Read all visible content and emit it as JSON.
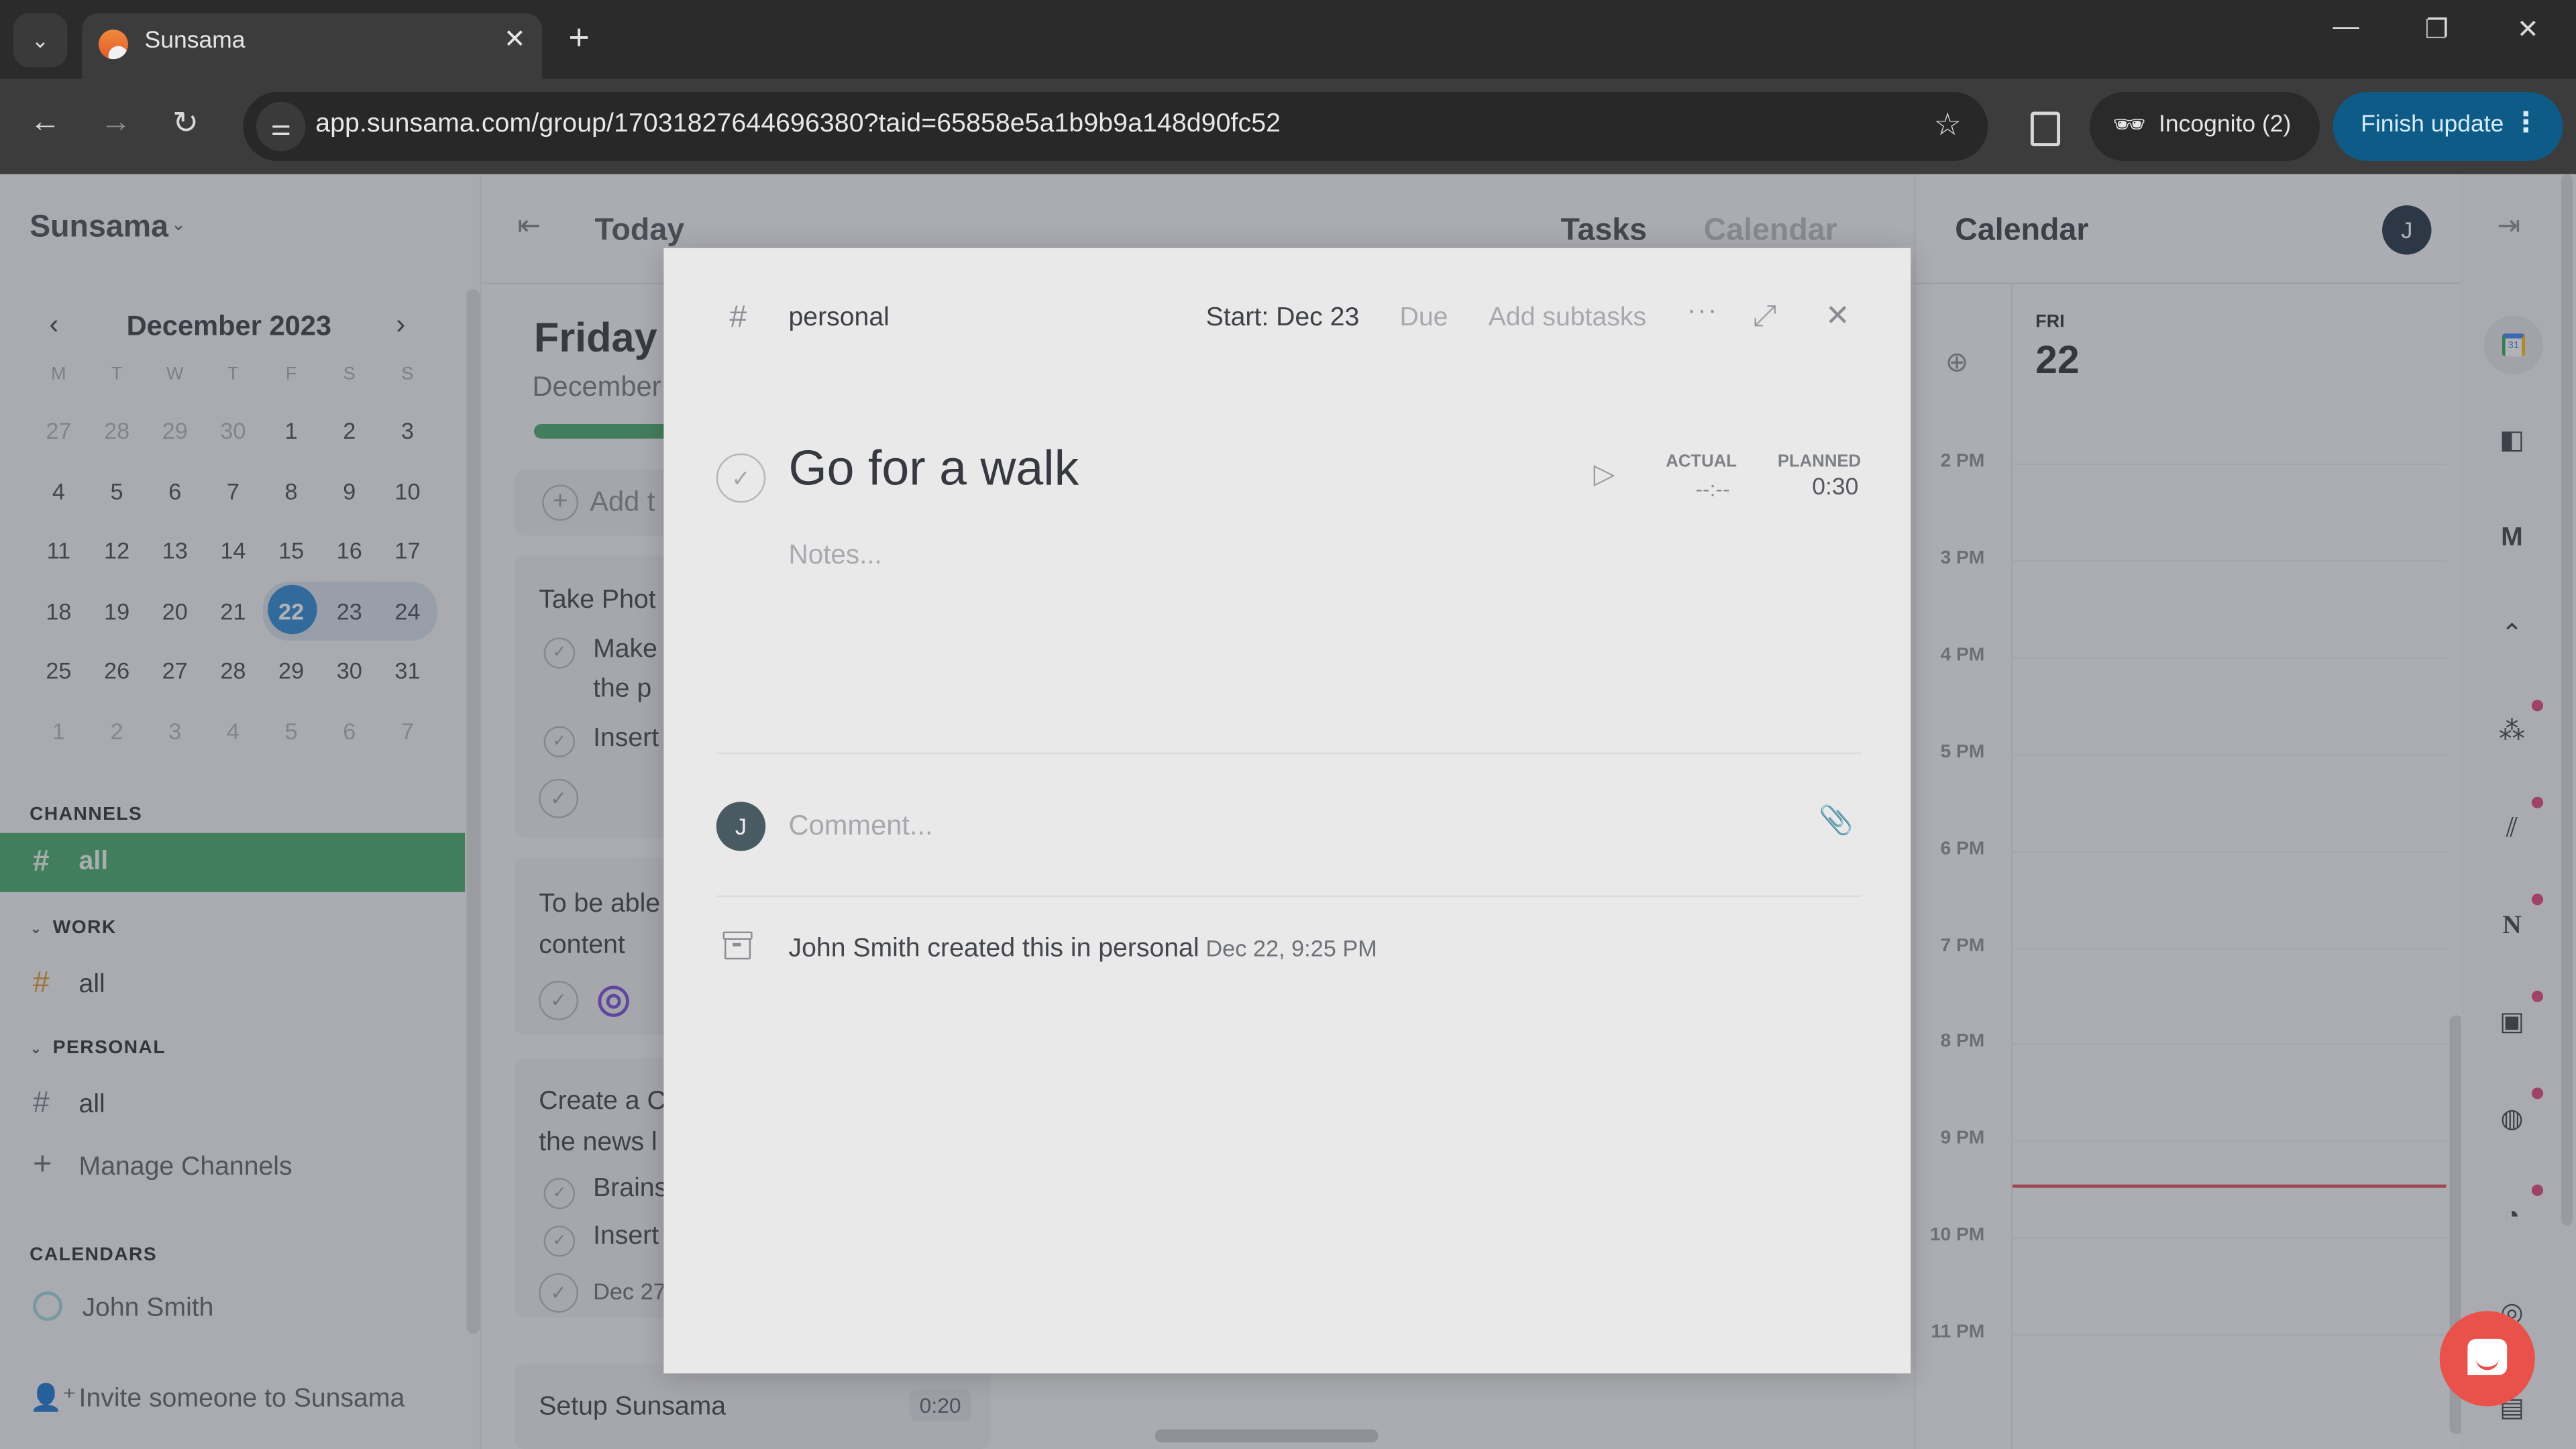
{
  "browser": {
    "tab_title": "Sunsama",
    "url": "app.sunsama.com/group/17031827644696380?taid=65858e5a1b9b9a148d90fc52",
    "incognito_label": "Incognito (2)",
    "finish_update_label": "Finish update",
    "icons": {
      "tab_search": "chevron-down-icon",
      "favicon": "sunsama-logo-icon",
      "close_tab": "close-icon",
      "new_tab": "plus-icon",
      "back": "arrow-left-icon",
      "forward": "arrow-right-icon",
      "reload": "reload-icon",
      "site_info": "tune-icon",
      "bookmark": "star-icon",
      "side_panel": "side-panel-icon",
      "incognito": "incognito-icon",
      "menu": "kebab-icon"
    },
    "window_controls": {
      "minimize": "—",
      "restore": "❐",
      "close": "✕"
    }
  },
  "sidebar": {
    "workspace": "Sunsama",
    "mini_calendar": {
      "month_label": "December 2023",
      "weekdays": [
        "M",
        "T",
        "W",
        "T",
        "F",
        "S",
        "S"
      ],
      "weeks": [
        [
          {
            "d": "27",
            "muted": true
          },
          {
            "d": "28",
            "muted": true
          },
          {
            "d": "29",
            "muted": true
          },
          {
            "d": "30",
            "muted": true
          },
          {
            "d": "1"
          },
          {
            "d": "2"
          },
          {
            "d": "3"
          }
        ],
        [
          {
            "d": "4"
          },
          {
            "d": "5"
          },
          {
            "d": "6"
          },
          {
            "d": "7"
          },
          {
            "d": "8"
          },
          {
            "d": "9"
          },
          {
            "d": "10"
          }
        ],
        [
          {
            "d": "11"
          },
          {
            "d": "12"
          },
          {
            "d": "13"
          },
          {
            "d": "14"
          },
          {
            "d": "15"
          },
          {
            "d": "16"
          },
          {
            "d": "17"
          }
        ],
        [
          {
            "d": "18"
          },
          {
            "d": "19"
          },
          {
            "d": "20"
          },
          {
            "d": "21"
          },
          {
            "d": "22",
            "today": true
          },
          {
            "d": "23",
            "hl": true
          },
          {
            "d": "24",
            "hl": true
          }
        ],
        [
          {
            "d": "25"
          },
          {
            "d": "26"
          },
          {
            "d": "27"
          },
          {
            "d": "28"
          },
          {
            "d": "29"
          },
          {
            "d": "30"
          },
          {
            "d": "31"
          }
        ],
        [
          {
            "d": "1",
            "muted": true
          },
          {
            "d": "2",
            "muted": true
          },
          {
            "d": "3",
            "muted": true
          },
          {
            "d": "4",
            "muted": true
          },
          {
            "d": "5",
            "muted": true
          },
          {
            "d": "6",
            "muted": true
          },
          {
            "d": "7",
            "muted": true
          }
        ]
      ]
    },
    "channels_label": "CHANNELS",
    "channel_all": "all",
    "groups": [
      {
        "label": "WORK",
        "channel": "all",
        "hash_color": "#e0952d"
      },
      {
        "label": "PERSONAL",
        "channel": "all",
        "hash_color": "#7a8290"
      }
    ],
    "manage_channels": "Manage Channels",
    "calendars_label": "CALENDARS",
    "calendar_user": "John Smith",
    "invite": "Invite someone to Sunsama",
    "accent": "#48a86a"
  },
  "main": {
    "header_title": "Today",
    "tabs": [
      "Tasks",
      "Calendar"
    ],
    "active_tab": "Tasks",
    "day_name": "Friday",
    "day_date": "December",
    "progress": 0.7,
    "add_task": "Add t",
    "cards": [
      {
        "title": "Take Phot",
        "subtasks": [
          "Make",
          "the p",
          "Insert"
        ]
      },
      {
        "title_lines": [
          "To be able",
          "content"
        ]
      },
      {
        "title_lines": [
          "Create a C",
          "the news l"
        ],
        "subtasks": [
          "Brains",
          "Insert"
        ],
        "date": "Dec 27"
      },
      {
        "title": "Setup Sunsama",
        "duration": "0:20"
      }
    ]
  },
  "calendar_panel": {
    "title": "Calendar",
    "avatar": "J",
    "day_of_week": "FRI",
    "day_number": "22",
    "hours": [
      "2 PM",
      "3 PM",
      "4 PM",
      "5 PM",
      "6 PM",
      "7 PM",
      "8 PM",
      "9 PM",
      "10 PM",
      "11 PM"
    ],
    "now_hour_fraction": 9.45
  },
  "right_rail": {
    "icons": [
      "google-calendar-icon",
      "trello-icon",
      "gmail-icon",
      "clickup-icon",
      "asana-icon",
      "monday-icon",
      "notion-icon",
      "outlook-icon",
      "linear-icon",
      "github-icon",
      "target-icon",
      "archive-icon"
    ],
    "notification_dots_on": [
      "asana-icon",
      "monday-icon",
      "notion-icon",
      "outlook-icon",
      "linear-icon",
      "github-icon"
    ]
  },
  "modal": {
    "channel": "personal",
    "start": "Start: Dec 23",
    "due": "Due",
    "add_subtasks": "Add subtasks",
    "more": "···",
    "task_title": "Go for a walk",
    "actual_label": "ACTUAL",
    "actual_value": "--:--",
    "planned_label": "PLANNED",
    "planned_value": "0:30",
    "notes_placeholder": "Notes...",
    "comment_avatar": "J",
    "comment_placeholder": "Comment...",
    "activity_text": "John Smith created this in personal",
    "activity_time": "Dec 22, 9:25 PM"
  }
}
